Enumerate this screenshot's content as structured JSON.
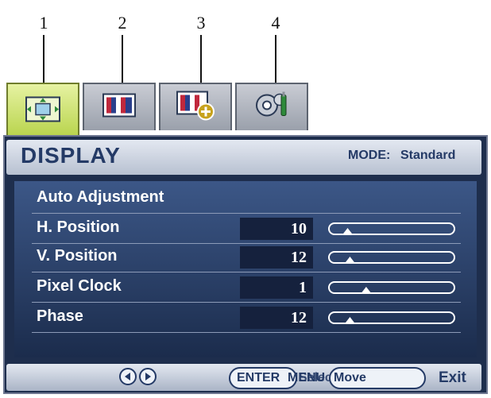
{
  "callouts": [
    "1",
    "2",
    "3",
    "4"
  ],
  "tabs": [
    {
      "icon": "display-tab-icon",
      "active": true
    },
    {
      "icon": "picture-tab-icon",
      "active": false
    },
    {
      "icon": "picture-advanced-tab-icon",
      "active": false
    },
    {
      "icon": "system-settings-tab-icon",
      "active": false
    }
  ],
  "header": {
    "title": "DISPLAY",
    "mode_label": "MODE:",
    "mode_value": "Standard"
  },
  "menu": {
    "auto_adjust_label": "Auto Adjustment",
    "items": [
      {
        "label": "H. Position",
        "value": "10",
        "level": 0.12
      },
      {
        "label": "V. Position",
        "value": "12",
        "level": 0.14
      },
      {
        "label": "Pixel Clock",
        "value": "1",
        "level": 0.28
      },
      {
        "label": "Phase",
        "value": "12",
        "level": 0.14
      }
    ]
  },
  "footer": {
    "enter_label": "ENTER",
    "menu_label": "MENU",
    "select_label": "Select",
    "move_label": "Move",
    "exit_label": "Exit"
  },
  "colors": {
    "panel": "#1e2e4d",
    "menu_bg": "#3c5787",
    "active_tab": "#b7d34a",
    "text_dark": "#243a66"
  }
}
